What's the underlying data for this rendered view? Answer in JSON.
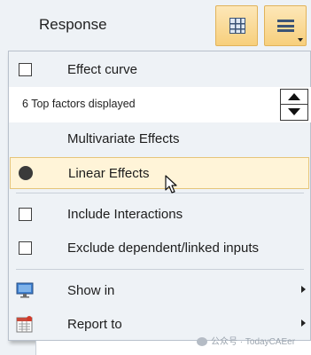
{
  "header": {
    "title": "Response",
    "grid_button_icon": "grid-table-icon",
    "menu_button_icon": "hamburger-menu-icon"
  },
  "menu": {
    "effect_curve": {
      "label": "Effect curve",
      "checked": false
    },
    "factors": {
      "label": "6 Top factors displayed",
      "value": 6
    },
    "multivariate": {
      "label": "Multivariate Effects"
    },
    "linear": {
      "label": "Linear Effects",
      "selected": true
    },
    "include_interactions": {
      "label": "Include Interactions",
      "checked": false
    },
    "exclude_dependent": {
      "label": "Exclude dependent/linked inputs",
      "checked": false
    },
    "show_in": {
      "label": "Show in",
      "icon": "monitor-icon"
    },
    "report_to": {
      "label": "Report to",
      "icon": "report-icon"
    }
  },
  "watermark": {
    "text": "公众号 · TodayCAEer"
  },
  "colors": {
    "highlight_bg": "#fff4d8",
    "highlight_border": "#e6c57a",
    "button_gradient_top": "#fde7b8",
    "button_gradient_bottom": "#f7cf7c",
    "background": "#eef2f6"
  }
}
